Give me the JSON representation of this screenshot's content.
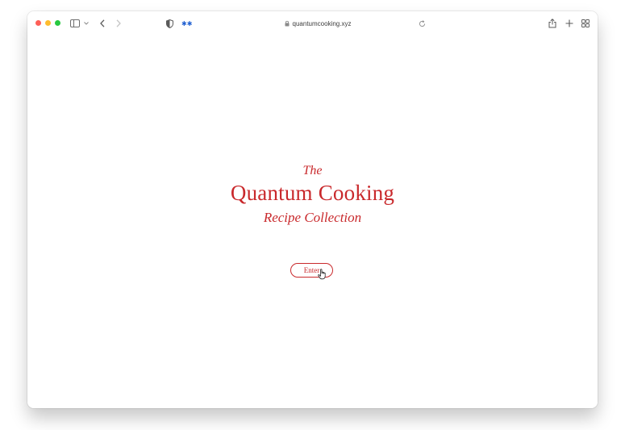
{
  "browser": {
    "url": "quantumcooking.xyz",
    "icons": {
      "sidebar": "sidebar-icon",
      "back": "chevron-left-icon",
      "forward": "chevron-right-icon",
      "shield": "shield-icon",
      "extension": "extension-icon",
      "lock": "lock-icon",
      "reload": "reload-icon",
      "share": "share-icon",
      "new_tab": "plus-icon",
      "tabs": "tab-overview-icon"
    }
  },
  "page": {
    "title_line1": "The",
    "title_line2": "Quantum Cooking",
    "title_line3": "Recipe Collection",
    "enter_label": "Enter",
    "accent_color": "#c9292c"
  }
}
